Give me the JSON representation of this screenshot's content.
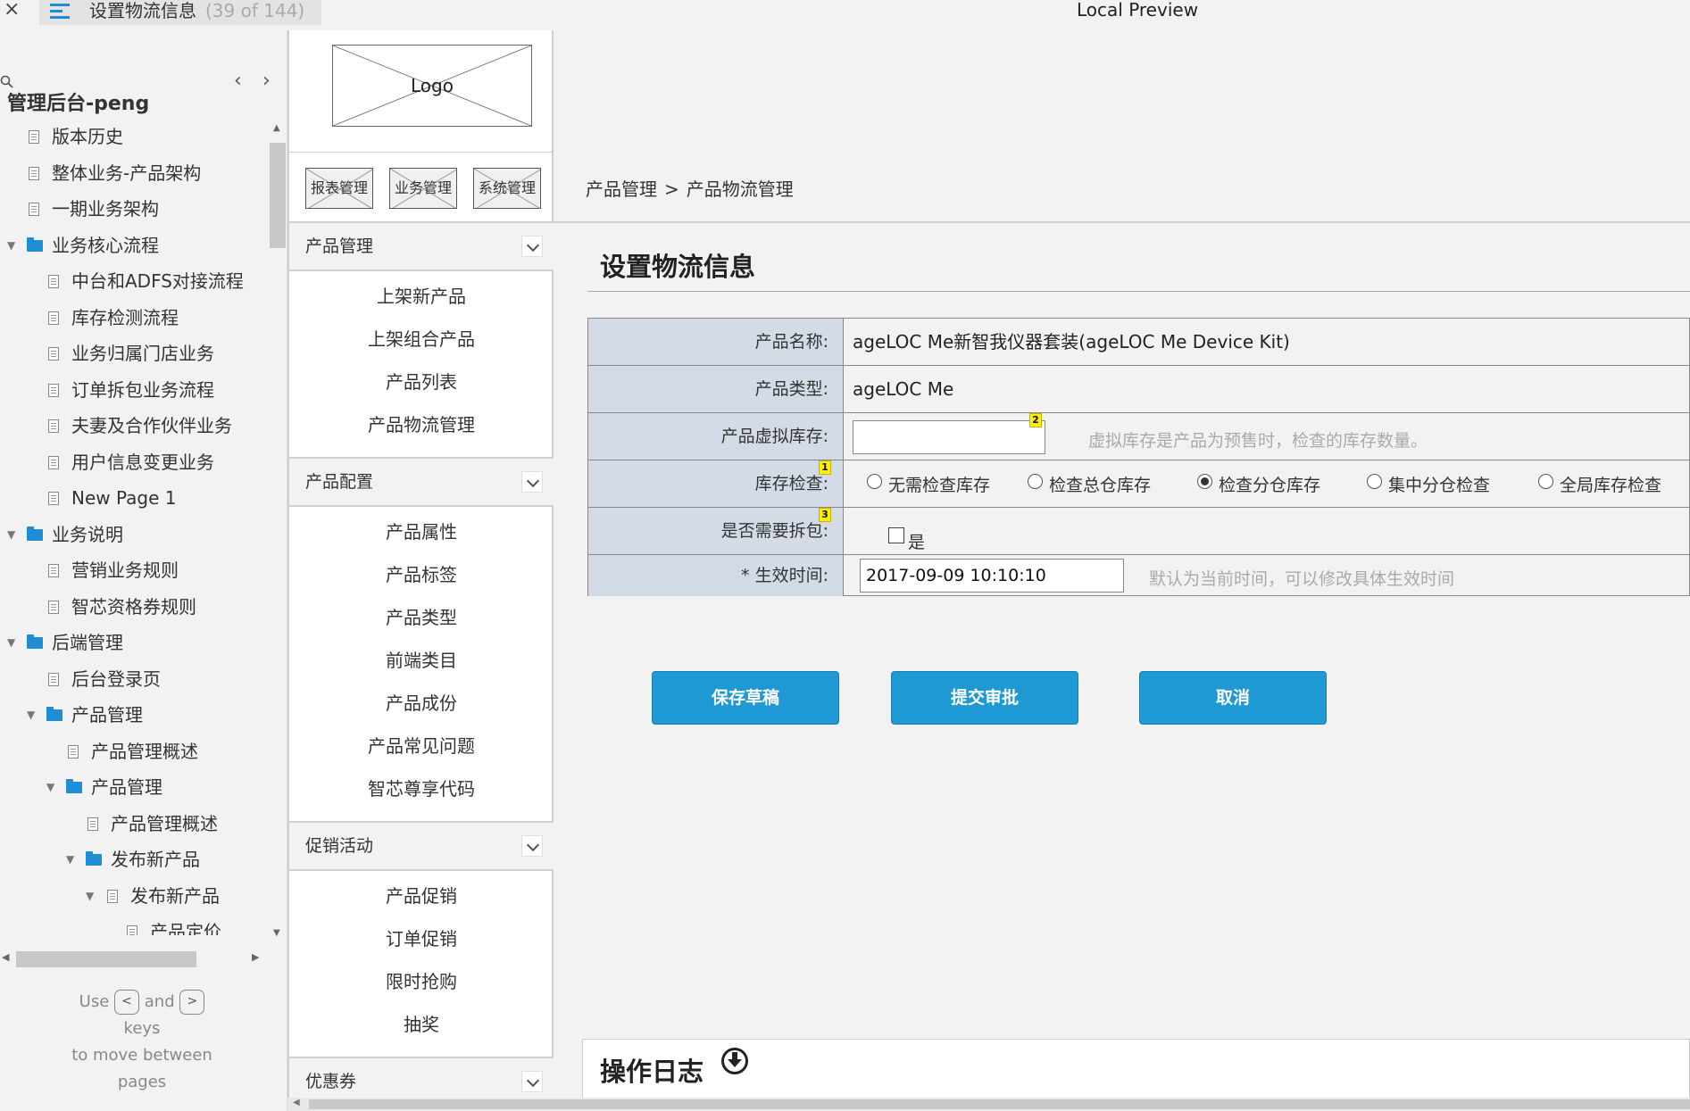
{
  "topbar": {
    "close_glyph": "×",
    "menu_icon": "hamburger-menu-icon",
    "page_title": "设置物流信息",
    "page_count": "(39 of 144)",
    "preview_title": "Local Preview"
  },
  "sitemap": {
    "search_icon": "search-icon",
    "prev_glyph": "‹",
    "next_glyph": "›",
    "project_name": "管理后台-peng",
    "tree": [
      {
        "label": "版本历史",
        "type": "page",
        "depth": 0
      },
      {
        "label": "整体业务-产品架构",
        "type": "page",
        "depth": 0
      },
      {
        "label": "一期业务架构",
        "type": "page",
        "depth": 0
      },
      {
        "label": "业务核心流程",
        "type": "folder",
        "depth": 0,
        "expanded": true
      },
      {
        "label": "中台和ADFS对接流程",
        "type": "page",
        "depth": 1
      },
      {
        "label": "库存检测流程",
        "type": "page",
        "depth": 1
      },
      {
        "label": "业务归属门店业务",
        "type": "page",
        "depth": 1
      },
      {
        "label": "订单拆包业务流程",
        "type": "page",
        "depth": 1
      },
      {
        "label": "夫妻及合作伙伴业务",
        "type": "page",
        "depth": 1
      },
      {
        "label": "用户信息变更业务",
        "type": "page",
        "depth": 1
      },
      {
        "label": "New Page 1",
        "type": "page",
        "depth": 1
      },
      {
        "label": "业务说明",
        "type": "folder",
        "depth": 0,
        "expanded": true
      },
      {
        "label": "营销业务规则",
        "type": "page",
        "depth": 1
      },
      {
        "label": "智芯资格券规则",
        "type": "page",
        "depth": 1
      },
      {
        "label": "后端管理",
        "type": "folder",
        "depth": 0,
        "expanded": true
      },
      {
        "label": "后台登录页",
        "type": "page",
        "depth": 1
      },
      {
        "label": "产品管理",
        "type": "folder",
        "depth": 1,
        "expanded": true
      },
      {
        "label": "产品管理概述",
        "type": "page",
        "depth": 2
      },
      {
        "label": "产品管理",
        "type": "folder",
        "depth": 2,
        "expanded": true
      },
      {
        "label": "产品管理概述",
        "type": "page",
        "depth": 3
      },
      {
        "label": "发布新产品",
        "type": "folder",
        "depth": 3,
        "expanded": true
      },
      {
        "label": "发布新产品",
        "type": "page",
        "depth": 4,
        "expanded": true
      },
      {
        "label": "产品定价",
        "type": "page",
        "depth": 5
      }
    ],
    "hint": {
      "use": "Use",
      "key_prev": "<",
      "and": "and",
      "key_next": ">",
      "keys": "keys",
      "line2": "to move between",
      "line3": "pages"
    }
  },
  "nav": {
    "logo_text": "Logo",
    "top_buttons": [
      "报表管理",
      "业务管理",
      "系统管理"
    ],
    "sections": [
      {
        "title": "产品管理",
        "items": [
          "上架新产品",
          "上架组合产品",
          "产品列表",
          "产品物流管理"
        ]
      },
      {
        "title": "产品配置",
        "items": [
          "产品属性",
          "产品标签",
          "产品类型",
          "前端类目",
          "产品成份",
          "产品常见问题",
          "智芯尊享代码"
        ]
      },
      {
        "title": "促销活动",
        "items": [
          "产品促销",
          "订单促销",
          "限时抢购",
          "抽奖"
        ]
      },
      {
        "title": "优惠券",
        "items": []
      }
    ],
    "chevron_icon": "chevron-down-icon"
  },
  "main": {
    "breadcrumb": {
      "parent": "产品管理",
      "separator": ">",
      "current": "产品物流管理"
    },
    "form_title": "设置物流信息",
    "form": {
      "product_name_label": "产品名称:",
      "product_name_value": "ageLOC Me新智我仪器套装(ageLOC Me Device Kit)",
      "product_type_label": "产品类型:",
      "product_type_value": "ageLOC Me",
      "virtual_stock_label": "产品虚拟库存:",
      "virtual_stock_value": "",
      "virtual_stock_note": "2",
      "virtual_stock_hint": "虚拟库存是产品为预售时，检查的库存数量。",
      "stock_check_label": "库存检查:",
      "stock_check_note": "1",
      "stock_check_options": [
        {
          "label": "无需检查库存",
          "checked": false
        },
        {
          "label": "检查总仓库存",
          "checked": false
        },
        {
          "label": "检查分仓库存",
          "checked": true
        },
        {
          "label": "集中分仓检查",
          "checked": false
        },
        {
          "label": "全局库存检查",
          "checked": false
        }
      ],
      "split_label": "是否需要拆包:",
      "split_note": "3",
      "split_option": "是",
      "split_checked": false,
      "effective_label": "* 生效时间:",
      "effective_value": "2017-09-09 10:10:10",
      "effective_hint": "默认为当前时间，可以修改具体生效时间"
    },
    "buttons": {
      "save_draft": "保存草稿",
      "submit": "提交审批",
      "cancel": "取消"
    },
    "log_title": "操作日志",
    "log_icon": "arrow-down-circle-icon"
  }
}
